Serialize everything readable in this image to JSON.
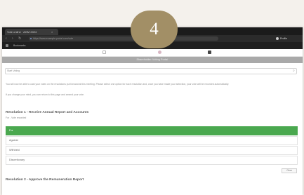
{
  "browser": {
    "tab_title": "Vote online · AGM 2024",
    "tab_close": "×",
    "nav_back": "‹",
    "nav_forward": "›",
    "nav_reload": "↻",
    "url": "https://www.example-portal.com/vote",
    "profile_label": "Profile"
  },
  "bookmarks": {
    "item": "Bookmarks"
  },
  "portal": {
    "banner_text": "Shareholder Voting Portal"
  },
  "search": {
    "label": "Start Voting",
    "icon": "search-icon"
  },
  "intro": {
    "paragraph1": "You will now be able to cast your votes on the resolutions put forward at this meeting. Please select one option for each resolution and, once you have made your selection, your vote will be recorded automatically.",
    "paragraph2": "If you change your mind, you can return to this page and amend your vote."
  },
  "resolutions": [
    {
      "title": "Resolution 1 - Receive Annual Report and Accounts",
      "subtitle": "For - Vote recorded",
      "options": [
        {
          "label": "For",
          "selected": true
        },
        {
          "label": "Against",
          "selected": false
        },
        {
          "label": "Withheld",
          "selected": false
        },
        {
          "label": "Discretionary",
          "selected": false
        }
      ],
      "clear_label": "Clear"
    },
    {
      "title": "Resolution 2 - Approve the Remuneration Report",
      "subtitle": ""
    }
  ],
  "overlay": {
    "step_number": "4"
  },
  "colors": {
    "selected_green": "#4aa84f",
    "badge_gold": "#a28f66",
    "browser_dark": "#1b1b1b"
  }
}
